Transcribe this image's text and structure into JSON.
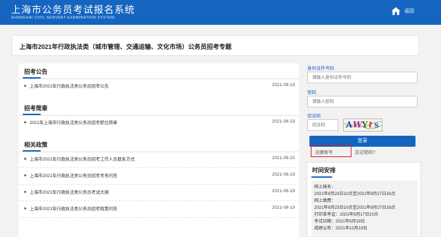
{
  "header": {
    "title": "上海市公务员考试报名系统",
    "subtitle": "SHANGHAI CIVIL SERVANT EXAMINATION SYSTEM",
    "home_label": "返回"
  },
  "page_title": "上海市2021年行政执法类（城市管理、交通运输、文化市场）公务员招考专题",
  "sections": {
    "announce": {
      "title": "招考公告",
      "items": [
        {
          "text": "上海市2021年行政执法类公务员招考公告",
          "date": "2021-08-19"
        }
      ]
    },
    "guide": {
      "title": "招考简章",
      "items": [
        {
          "text": "2021年上海市行政执法类公务员招考职位简章",
          "date": "2021-08-19"
        }
      ]
    },
    "policy": {
      "title": "相关政策",
      "items": [
        {
          "text": "上海市2021年行政执法类公务员招考工作人员联系方式",
          "date": "2021-08-20"
        },
        {
          "text": "上海市2021年行政执法类公务员招考考务问答",
          "date": "2021-08-19"
        },
        {
          "text": "上海市2021年行政执法类公务员考试大纲",
          "date": "2021-08-19"
        },
        {
          "text": "上海市2021年行政执法类公务员招考政策问答",
          "date": "2021-08-19"
        }
      ]
    }
  },
  "login": {
    "id_label": "身份证件号码",
    "id_placeholder": "请输入身份证件号码",
    "password_label": "密码",
    "password_placeholder": "请输入密码",
    "captcha_label": "验证码",
    "captcha_placeholder": "验证码",
    "captcha_chars": [
      "A",
      "W",
      "Y",
      "t",
      "s"
    ],
    "login_button": "登录",
    "register_link": "注册账号",
    "forgot_link": "忘记密码?"
  },
  "schedule": {
    "title": "时间安排",
    "lines": [
      "网上报名：",
      "2021年8月23日10点至2021年8月27日16点",
      "网上缴费：",
      "2021年8月23日10点至2021年8月27日18点",
      "打印准考证：2021年9月17日10点",
      "考试日期：2021年9月19日",
      "成绩公布：2021年10月19日"
    ]
  },
  "colors": {
    "brand": "#1565c0",
    "highlight": "#e0141e"
  }
}
